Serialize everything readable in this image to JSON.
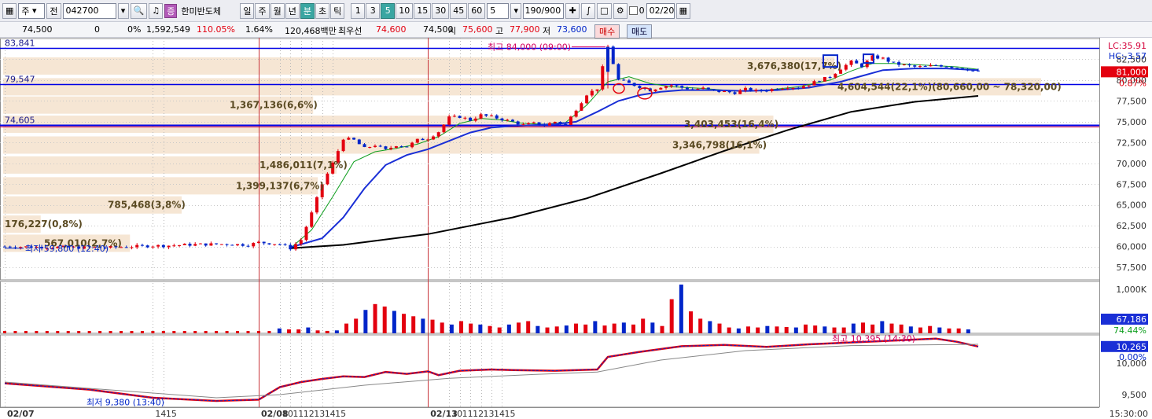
{
  "toolbar": {
    "market_selector": "주",
    "prev_label": "전",
    "stock_code": "042700",
    "stock_name": "한미반도체",
    "period_tabs": [
      "일",
      "주",
      "월",
      "년",
      "분",
      "초",
      "틱"
    ],
    "active_period": "분",
    "interval_tabs": [
      "1",
      "3",
      "5",
      "10",
      "15",
      "30",
      "45",
      "60"
    ],
    "active_interval": "5",
    "interval_input": "5",
    "count_display": "190/900",
    "checkbox_label": "0",
    "date_value": "02/20"
  },
  "info_row": {
    "price": "74,500",
    "change": "0",
    "change_pct": "0%",
    "volume": "1,592,549",
    "volume_ratio": "110.05%",
    "turnover": "1.64%",
    "amount": "120,468백만",
    "best_ask_label": "최우선",
    "best_ask": "74,600",
    "best_bid": "74,500",
    "open_label": "시",
    "open": "75,600",
    "high_label": "고",
    "high": "77,900",
    "low_label": "저",
    "low": "73,600",
    "buy_button": "매수",
    "sell_button": "매도"
  },
  "colors": {
    "up": "#e3000f",
    "down": "#0025c9",
    "hline": "#0000e6",
    "volume_band": "#f6e6d4",
    "ma5": "#0f9f1f",
    "ma20": "#1a2fd6",
    "ma120": "#000000"
  },
  "chart_data": [
    {
      "type": "candlestick",
      "title": "",
      "ylim": [
        56000,
        85000
      ],
      "y_ticks": [
        "82,500",
        "80,000",
        "77,500",
        "75,000",
        "72,500",
        "70,000",
        "67,500",
        "65,000",
        "62,500",
        "60,000",
        "57,500"
      ],
      "y_tick_values": [
        82500,
        80000,
        77500,
        75000,
        72500,
        70000,
        67500,
        65000,
        62500,
        60000,
        57500
      ],
      "top_right_labels": [
        "LC:35.91",
        "HC:-3.57"
      ],
      "current_price_label": "81,000",
      "current_price": 81000,
      "current_pct_label": "0.87%",
      "x_labels": [
        "02/07",
        "14",
        "15",
        "02/08",
        "10",
        "11",
        "12",
        "13",
        "14",
        "15",
        "02/13",
        "10",
        "11",
        "12",
        "13",
        "14",
        "15"
      ],
      "x_label_times": [
        0,
        14,
        15,
        24,
        26,
        27,
        28,
        29,
        30,
        31,
        40,
        42,
        43,
        44,
        45,
        46,
        47
      ],
      "h_lines": [
        {
          "label": "83,841",
          "value": 83841
        },
        {
          "label": "79,547",
          "value": 79547
        },
        {
          "label": "74,605",
          "value": 74605
        }
      ],
      "annotations": [
        {
          "text": "최고 84,000 (09:00)",
          "kind": "high"
        },
        {
          "text": "최저 59,800 (12:40)",
          "kind": "low"
        }
      ],
      "volume_profile": [
        {
          "label": "3,676,380(17,7%)",
          "price": 81700
        },
        {
          "label": "4,604,544(22,1%)(80,660,00 ~ 78,320,00)",
          "price": 79200
        },
        {
          "label": "1,367,136(6,6%)",
          "price": 77000
        },
        {
          "label": "3,403,453(16,4%)",
          "price": 74700
        },
        {
          "label": "3,346,798(16,1%)",
          "price": 72200
        },
        {
          "label": "1,486,011(7,1%)",
          "price": 69800
        },
        {
          "label": "1,399,137(6,7%)",
          "price": 67300
        },
        {
          "label": "785,468(3,8%)",
          "price": 65000
        },
        {
          "label": "176,227(0,8%)",
          "price": 62700
        },
        {
          "label": "567,010(2,7%)",
          "price": 60400
        }
      ],
      "price_path": [
        [
          0,
          60000
        ],
        [
          6,
          59900
        ],
        [
          10,
          59900
        ],
        [
          14,
          60100
        ],
        [
          15,
          60100
        ],
        [
          18,
          60250
        ],
        [
          21,
          60300
        ],
        [
          23,
          60200
        ],
        [
          24,
          60500
        ],
        [
          26,
          60300
        ],
        [
          27,
          59800
        ],
        [
          28,
          60800
        ],
        [
          29,
          64000
        ],
        [
          30,
          67500
        ],
        [
          31,
          70000
        ],
        [
          32,
          73000
        ],
        [
          33,
          72800
        ],
        [
          34,
          71800
        ],
        [
          35,
          72200
        ],
        [
          36,
          71600
        ],
        [
          37,
          72200
        ],
        [
          38,
          72000
        ],
        [
          39,
          72800
        ],
        [
          40,
          73000
        ],
        [
          41,
          73800
        ],
        [
          42,
          75500
        ],
        [
          43,
          75600
        ],
        [
          44,
          75200
        ],
        [
          45,
          75800
        ],
        [
          46,
          75600
        ],
        [
          47,
          75300
        ],
        [
          48,
          75000
        ],
        [
          49,
          74600
        ],
        [
          50,
          74800
        ],
        [
          51,
          74600
        ],
        [
          52,
          75000
        ],
        [
          53,
          74600
        ],
        [
          54,
          76500
        ],
        [
          55,
          78300
        ],
        [
          56,
          79000
        ],
        [
          57,
          84000
        ],
        [
          58,
          80000
        ],
        [
          59,
          79600
        ],
        [
          60,
          79200
        ],
        [
          61,
          78800
        ],
        [
          62,
          79200
        ],
        [
          63,
          79400
        ],
        [
          64,
          79100
        ],
        [
          65,
          78900
        ],
        [
          66,
          79000
        ],
        [
          67,
          78700
        ],
        [
          68,
          78600
        ],
        [
          69,
          78500
        ],
        [
          70,
          78900
        ],
        [
          71,
          78700
        ],
        [
          72,
          78800
        ],
        [
          73,
          79000
        ],
        [
          74,
          79200
        ],
        [
          75,
          79100
        ],
        [
          76,
          79500
        ],
        [
          77,
          80000
        ],
        [
          78,
          80400
        ],
        [
          79,
          81400
        ],
        [
          80,
          82200
        ],
        [
          81,
          81700
        ],
        [
          82,
          82800
        ],
        [
          83,
          82600
        ],
        [
          84,
          82000
        ],
        [
          85,
          81800
        ],
        [
          86,
          81600
        ],
        [
          87,
          81600
        ],
        [
          88,
          81800
        ],
        [
          89,
          81700
        ],
        [
          90,
          81500
        ],
        [
          91,
          81300
        ],
        [
          92,
          81000
        ]
      ],
      "ma_series": [
        {
          "color_key": "ma5",
          "points": [
            [
              27,
              59800
            ],
            [
              29,
              62000
            ],
            [
              31,
              66000
            ],
            [
              33,
              70200
            ],
            [
              35,
              71400
            ],
            [
              37,
              71800
            ],
            [
              39,
              72300
            ],
            [
              41,
              73200
            ],
            [
              43,
              74800
            ],
            [
              45,
              75400
            ],
            [
              47,
              75200
            ],
            [
              49,
              74800
            ],
            [
              51,
              74700
            ],
            [
              53,
              74900
            ],
            [
              55,
              77000
            ],
            [
              57,
              79800
            ],
            [
              59,
              80400
            ],
            [
              61,
              79600
            ],
            [
              63,
              79200
            ],
            [
              66,
              79000
            ],
            [
              69,
              78700
            ],
            [
              72,
              78800
            ],
            [
              75,
              79200
            ],
            [
              78,
              80000
            ],
            [
              80,
              81100
            ],
            [
              82,
              82000
            ],
            [
              84,
              82000
            ],
            [
              87,
              81800
            ],
            [
              90,
              81600
            ],
            [
              92,
              81300
            ]
          ]
        },
        {
          "color_key": "ma20",
          "points": [
            [
              27,
              59900
            ],
            [
              30,
              61000
            ],
            [
              32,
              63500
            ],
            [
              34,
              67000
            ],
            [
              36,
              69800
            ],
            [
              38,
              71000
            ],
            [
              40,
              71700
            ],
            [
              42,
              72700
            ],
            [
              44,
              73700
            ],
            [
              46,
              74300
            ],
            [
              48,
              74500
            ],
            [
              50,
              74600
            ],
            [
              52,
              74700
            ],
            [
              54,
              75000
            ],
            [
              56,
              76200
            ],
            [
              58,
              77500
            ],
            [
              60,
              78200
            ],
            [
              62,
              78600
            ],
            [
              64,
              78800
            ],
            [
              67,
              78800
            ],
            [
              70,
              78700
            ],
            [
              73,
              78800
            ],
            [
              76,
              79100
            ],
            [
              79,
              79800
            ],
            [
              81,
              80500
            ],
            [
              83,
              81200
            ],
            [
              86,
              81400
            ],
            [
              89,
              81400
            ],
            [
              92,
              81200
            ]
          ]
        },
        {
          "color_key": "ma120",
          "points": [
            [
              27,
              59800
            ],
            [
              32,
              60200
            ],
            [
              40,
              61500
            ],
            [
              48,
              63500
            ],
            [
              55,
              65800
            ],
            [
              62,
              68800
            ],
            [
              68,
              71500
            ],
            [
              74,
              74000
            ],
            [
              80,
              76200
            ],
            [
              86,
              77400
            ],
            [
              92,
              78100
            ]
          ]
        }
      ]
    },
    {
      "type": "bar",
      "title": "",
      "y_ticks": [
        "1,000K"
      ],
      "value_labels": [
        "67,186",
        "74.44%"
      ],
      "volumes": [
        10,
        8,
        8,
        12,
        6,
        5,
        6,
        20,
        30,
        48,
        60,
        55,
        46,
        40,
        35,
        30,
        28,
        22,
        18,
        25,
        20,
        18,
        15,
        12,
        18,
        22,
        25,
        15,
        12,
        14,
        16,
        20,
        18,
        25,
        16,
        20,
        22,
        18,
        30,
        22,
        15,
        70,
        100,
        45,
        30,
        25,
        20,
        12,
        10,
        14,
        12,
        15,
        14,
        13,
        12,
        18,
        16,
        14,
        12,
        12,
        20,
        22,
        18,
        25,
        20,
        18,
        14,
        12,
        15,
        12,
        10,
        10,
        8
      ]
    },
    {
      "type": "line",
      "title": "",
      "y_ticks": [
        "10,000",
        "9,500"
      ],
      "value_labels": [
        "10,265",
        "0.00%"
      ],
      "annotations": [
        {
          "text": "최고 10,395 (14:30)",
          "kind": "high"
        },
        {
          "text": "최저 9,380 (13:40)",
          "kind": "low"
        }
      ],
      "x_labels": [
        "02/07",
        "14",
        "15",
        "02/08",
        "10",
        "11",
        "12",
        "13",
        "14",
        "15",
        "02/13",
        "10",
        "11",
        "12",
        "13",
        "14",
        "15"
      ],
      "time_label": "15:30:00"
    }
  ]
}
